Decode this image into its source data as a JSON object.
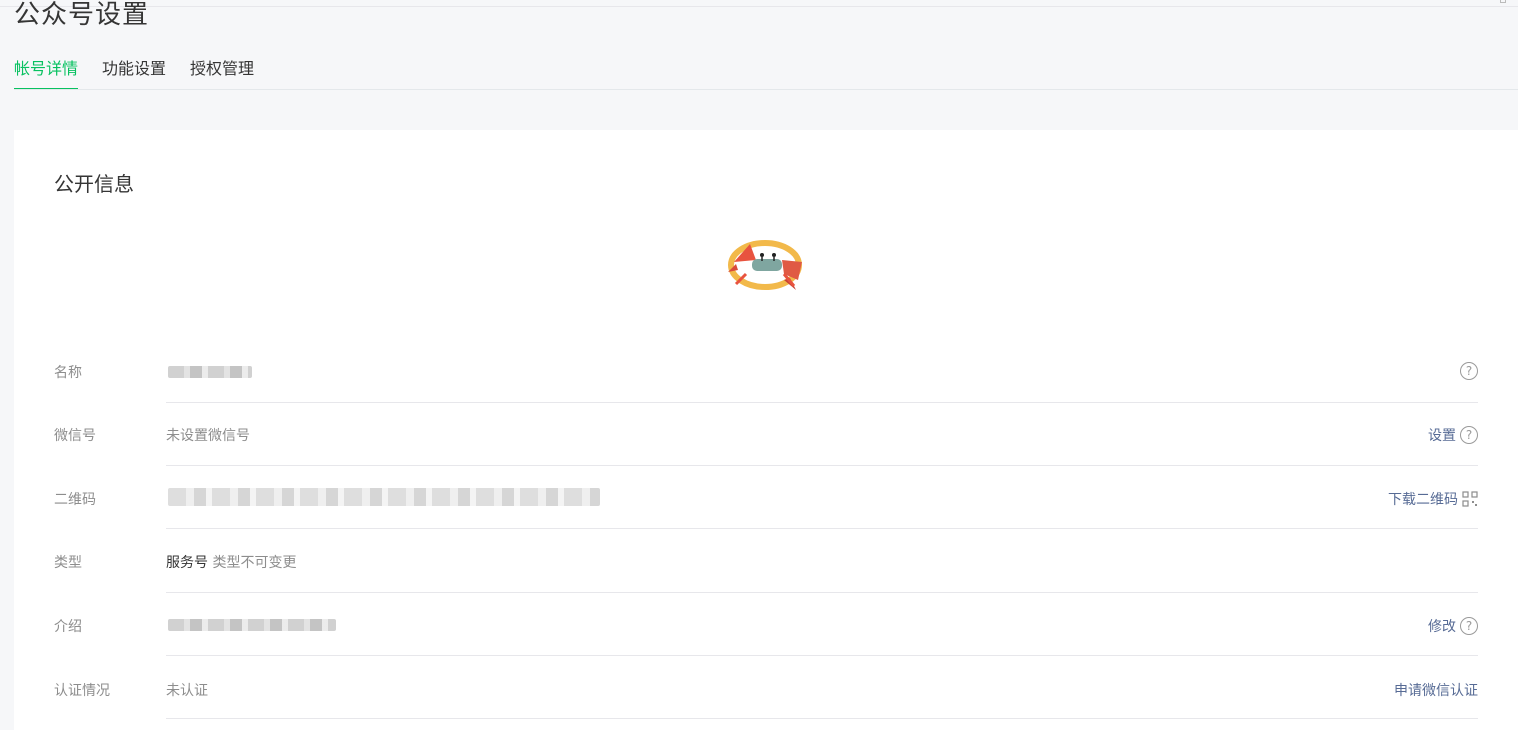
{
  "page": {
    "title": "公众号设置"
  },
  "tabs": [
    {
      "label": "帐号详情",
      "active": true
    },
    {
      "label": "功能设置",
      "active": false
    },
    {
      "label": "授权管理",
      "active": false
    }
  ],
  "section": {
    "title": "公开信息"
  },
  "rows": {
    "name": {
      "label": "名称",
      "value": ""
    },
    "wechat_id": {
      "label": "微信号",
      "value": "未设置微信号",
      "action": "设置"
    },
    "qrcode": {
      "label": "二维码",
      "value": "",
      "action": "下载二维码"
    },
    "type": {
      "label": "类型",
      "value_main": "服务号",
      "value_note": "类型不可变更"
    },
    "intro": {
      "label": "介绍",
      "value": "",
      "action": "修改"
    },
    "verification": {
      "label": "认证情况",
      "value": "未认证",
      "action": "申请微信认证"
    }
  },
  "icons": {
    "help": "?"
  },
  "colors": {
    "accent": "#07c160",
    "link": "#576b95",
    "muted": "#8d8d8d",
    "text": "#353535"
  }
}
